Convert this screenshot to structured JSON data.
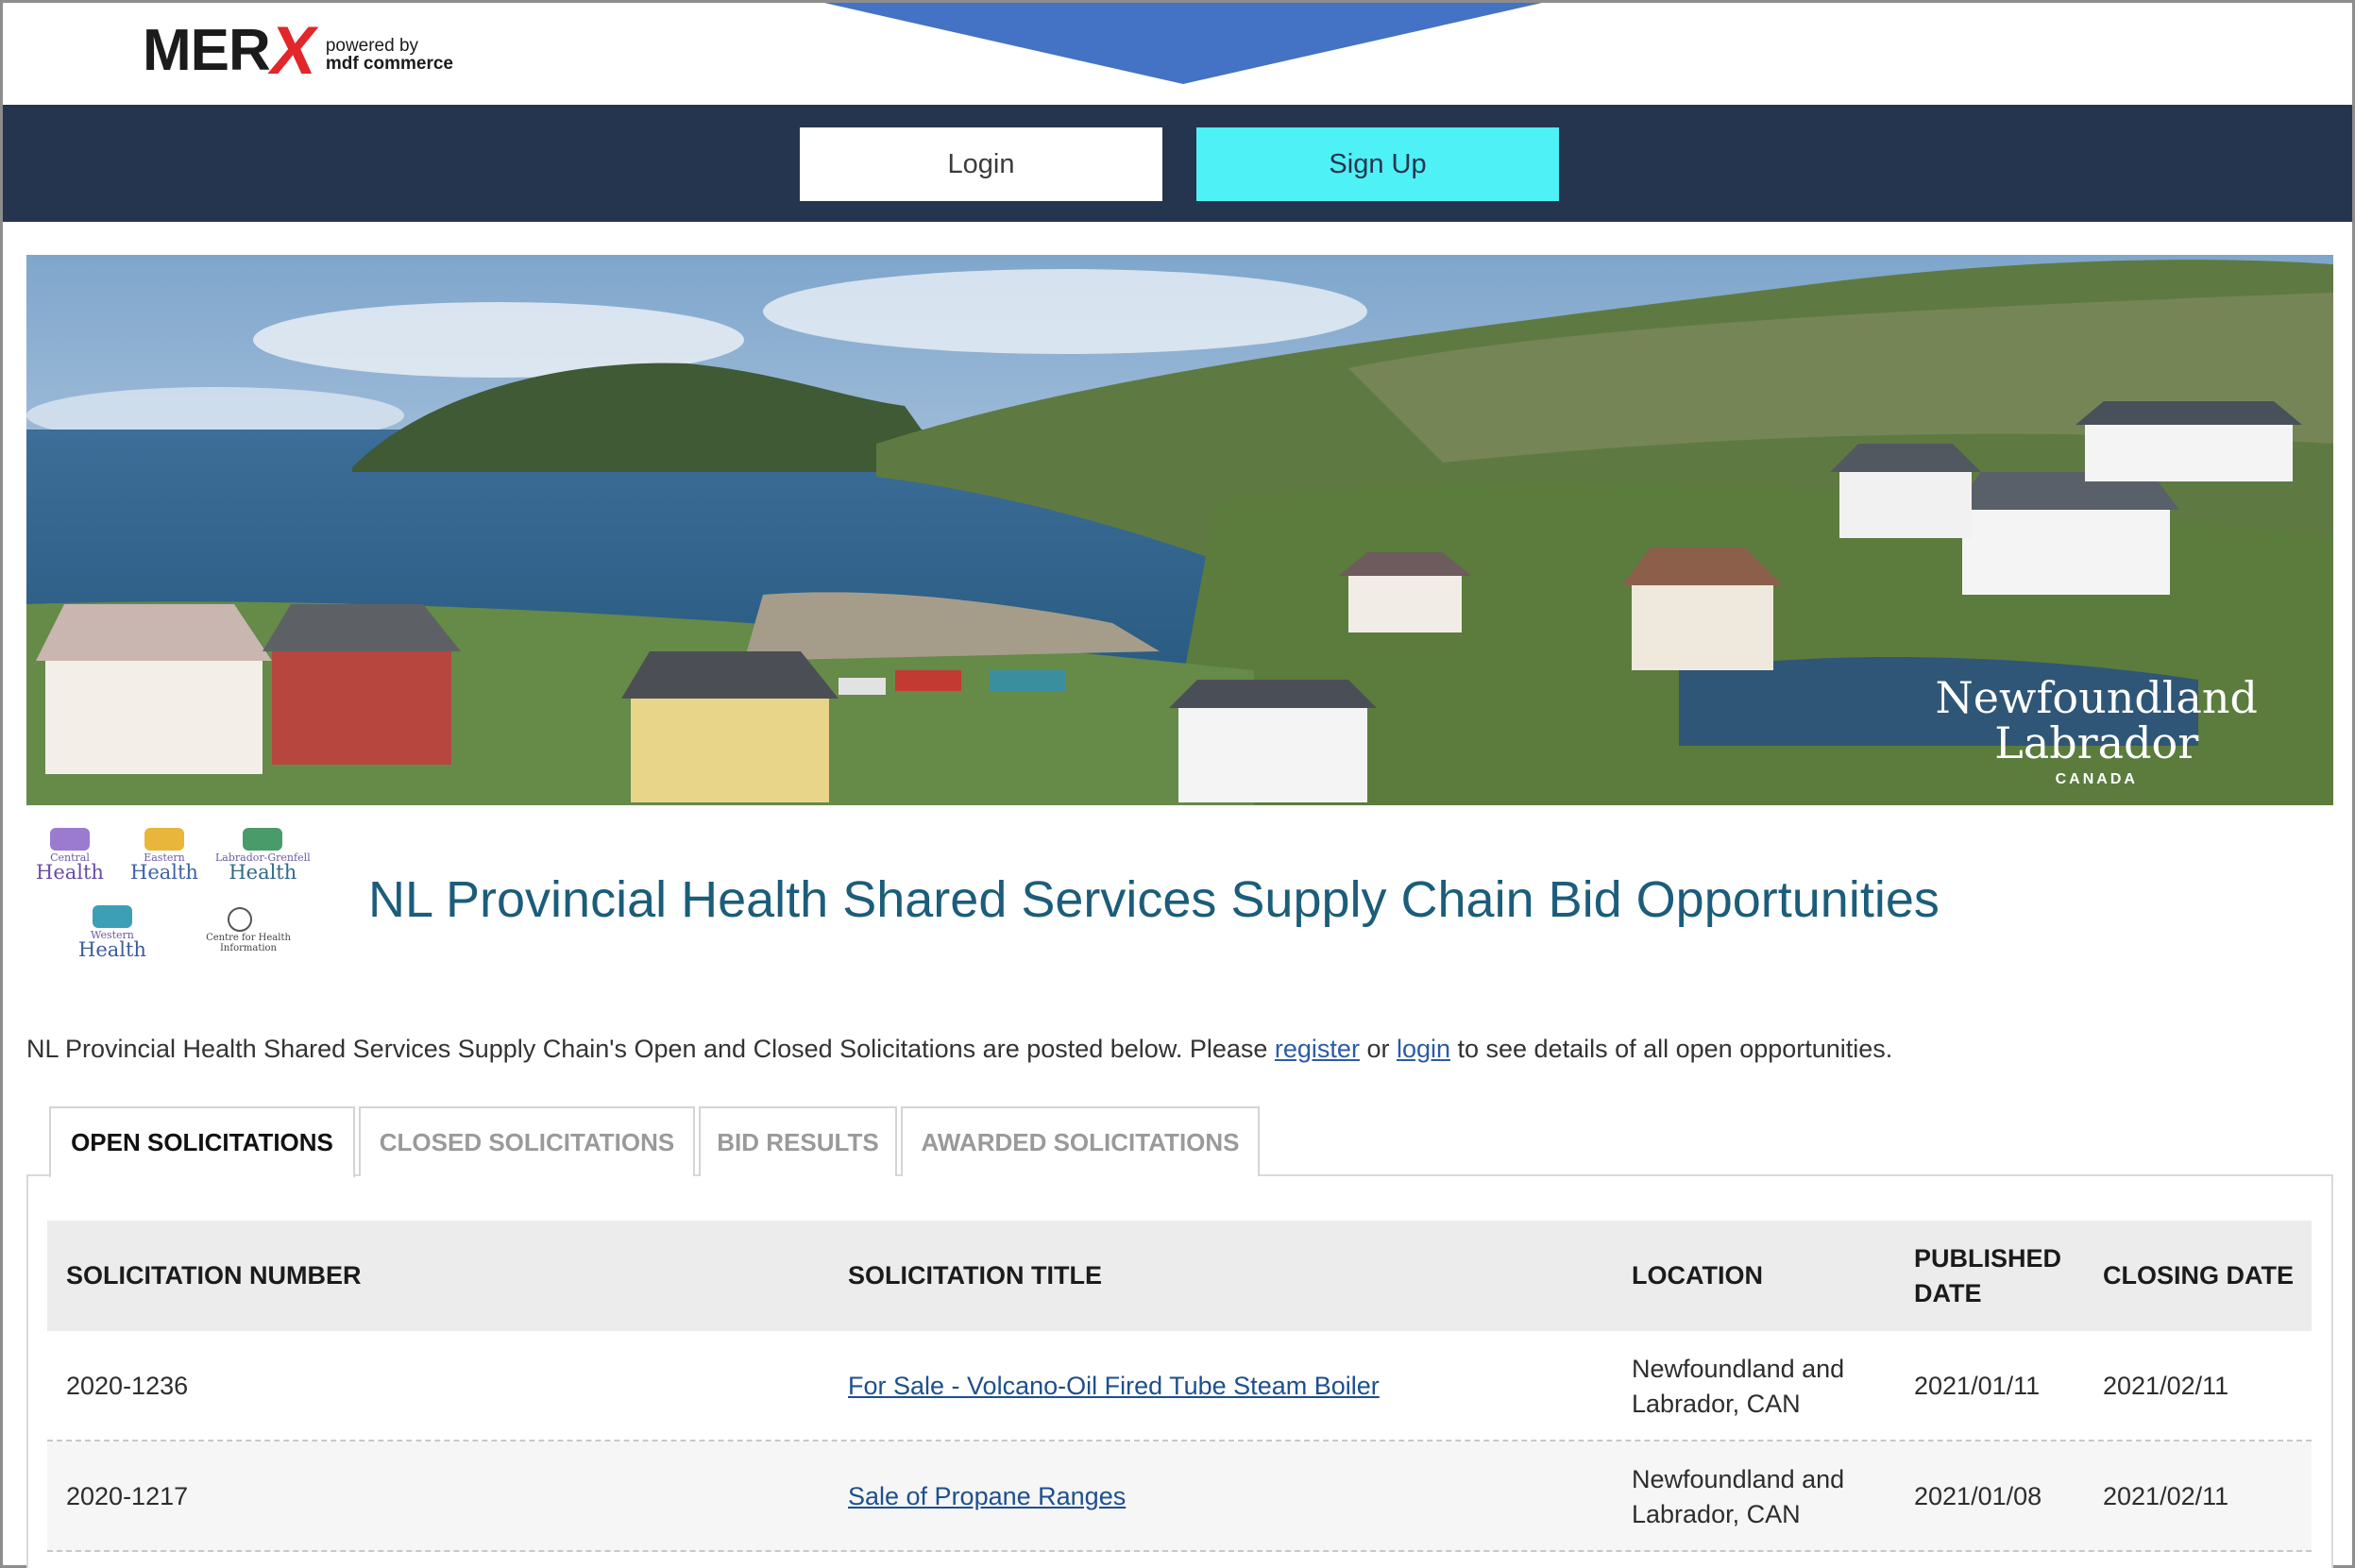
{
  "header": {
    "logo_text": "MER",
    "logo_x": "X",
    "powered_line1": "powered by",
    "powered_line2": "mdf commerce",
    "login_label": "Login",
    "signup_label": "Sign Up"
  },
  "hero": {
    "brand_line1": "Newfoundland",
    "brand_line2": "Labrador",
    "brand_line3": "CANADA"
  },
  "health_logos": [
    {
      "small": "Central",
      "big": "Health"
    },
    {
      "small": "Eastern",
      "big": "Health"
    },
    {
      "small": "Labrador-Grenfell",
      "big": "Health"
    },
    {
      "small": "Western",
      "big": "Health"
    },
    {
      "small": "Centre for Health Information",
      "big": ""
    }
  ],
  "page_title": "NL Provincial Health Shared Services Supply Chain Bid Opportunities",
  "intro": {
    "before": "NL Provincial Health Shared Services Supply Chain's Open and Closed Solicitations are posted below. Please ",
    "register": "register",
    "middle": " or ",
    "login": "login",
    "after": " to see details of all open opportunities."
  },
  "tabs": [
    {
      "label": "OPEN SOLICITATIONS",
      "active": true
    },
    {
      "label": "CLOSED SOLICITATIONS",
      "active": false
    },
    {
      "label": "BID RESULTS",
      "active": false
    },
    {
      "label": "AWARDED SOLICITATIONS",
      "active": false
    }
  ],
  "table": {
    "headers": [
      "SOLICITATION NUMBER",
      "SOLICITATION TITLE",
      "LOCATION",
      "PUBLISHED DATE",
      "CLOSING DATE"
    ],
    "rows": [
      {
        "number": "2020-1236",
        "title": "For Sale - Volcano-Oil Fired Tube Steam Boiler",
        "location": "Newfoundland and Labrador, CAN",
        "published": "2021/01/11",
        "closing": "2021/02/11"
      },
      {
        "number": "2020-1217",
        "title": "Sale of Propane Ranges",
        "location": "Newfoundland and Labrador, CAN",
        "published": "2021/01/08",
        "closing": "2021/02/11"
      }
    ]
  },
  "colors": {
    "navbar": "#26354f",
    "signup": "#4ef1f5",
    "chevron": "#4472c4",
    "title": "#1b5d7a",
    "logo_x": "#e2262a"
  }
}
